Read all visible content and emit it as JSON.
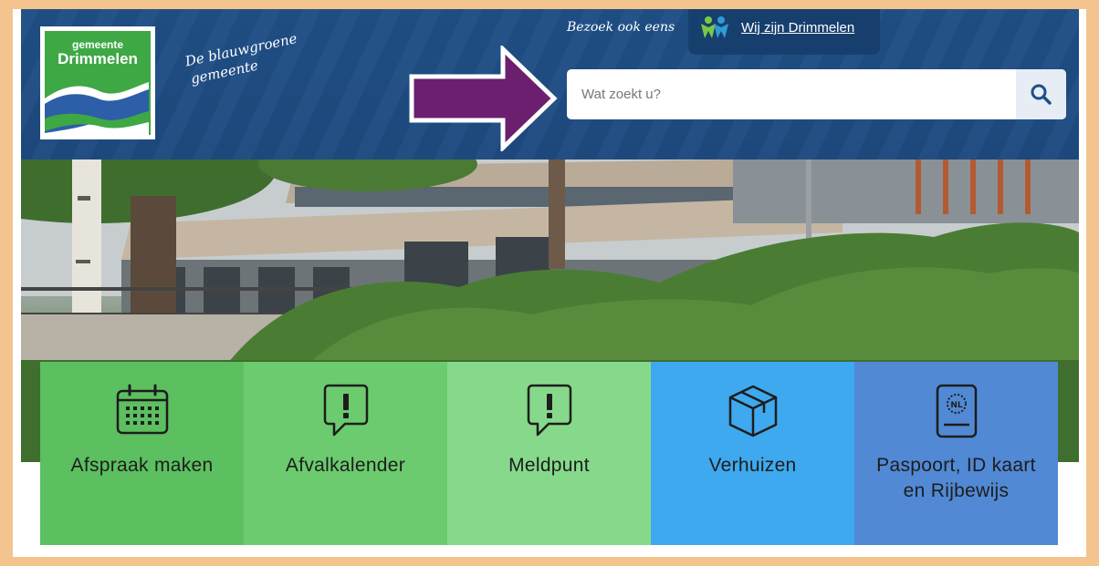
{
  "logo": {
    "line1": "gemeente",
    "line2": "Drimmelen"
  },
  "tagline": {
    "line1": "De blauwgroene",
    "line2": "gemeente"
  },
  "visit": {
    "label": "Bezoek ook eens",
    "link_text": "Wij zijn Drimmelen"
  },
  "search": {
    "placeholder": "Wat zoekt u?",
    "value": ""
  },
  "tiles": [
    {
      "label": "Afspraak maken",
      "icon": "calendar-icon",
      "color": "#5cbf60"
    },
    {
      "label": "Afvalkalender",
      "icon": "speech-exclamation-icon",
      "color": "#6ccb6f"
    },
    {
      "label": "Meldpunt",
      "icon": "speech-exclamation-icon",
      "color": "#86d98a"
    },
    {
      "label": "Verhuizen",
      "icon": "box-icon",
      "color": "#3ea9ee"
    },
    {
      "label": "Paspoort, ID kaart en Rijbewijs",
      "icon": "passport-icon",
      "color": "#5189d4"
    }
  ],
  "colors": {
    "header": "#1f4f86",
    "arrow": "#6b1f6e",
    "frame": "#f3c48e",
    "logo_green": "#3ea845"
  }
}
